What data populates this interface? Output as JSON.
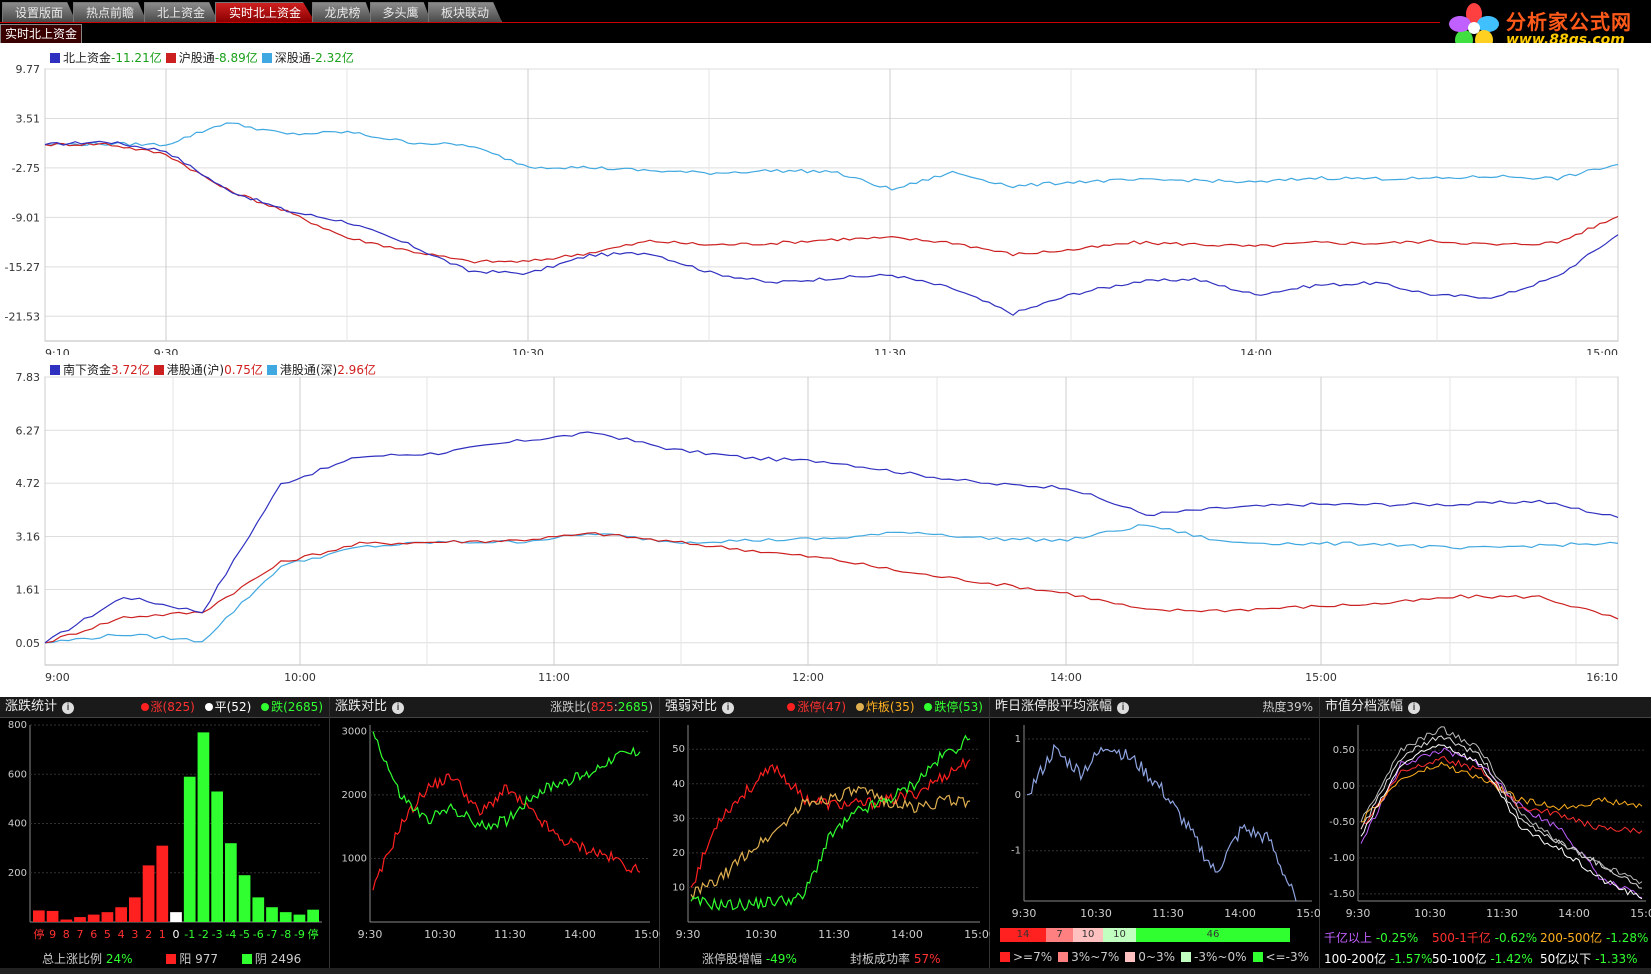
{
  "tabs": [
    {
      "label": "设置版面",
      "active": false
    },
    {
      "label": "热点前瞻",
      "active": false
    },
    {
      "label": "北上资金",
      "active": false
    },
    {
      "label": "实时北上资金",
      "active": true
    },
    {
      "label": "龙虎榜",
      "active": false
    },
    {
      "label": "多头鹰",
      "active": false
    },
    {
      "label": "板块联动",
      "active": false
    }
  ],
  "subtab": "实时北上资金",
  "logo": {
    "brand": "分析家公式网",
    "url": "www.88gs.com"
  },
  "colors": {
    "blue": "#3030c0",
    "red": "#cc2020",
    "cyan": "#40a8e0",
    "green": "#30ff30",
    "bred": "#ff2020",
    "yellow": "#e0b050"
  },
  "north": {
    "legend": [
      {
        "name": "北上资金",
        "value": "-11.21亿",
        "color": "#3030c0",
        "vclass": "v-green"
      },
      {
        "name": "沪股通",
        "value": "-8.89亿",
        "color": "#cc2020",
        "vclass": "v-green"
      },
      {
        "name": "深股通",
        "value": "-2.32亿",
        "color": "#40a8e0",
        "vclass": "v-green"
      }
    ],
    "y_ticks": [
      "9.77",
      "3.51",
      "-2.75",
      "-9.01",
      "-15.27",
      "-21.53"
    ],
    "x_ticks": [
      "9:10",
      "9:30",
      "10:30",
      "11:30",
      "14:00",
      "15:00"
    ]
  },
  "south": {
    "legend": [
      {
        "name": "南下资金",
        "value": "3.72亿",
        "color": "#3030c0",
        "vclass": "v-red"
      },
      {
        "name": "港股通(沪)",
        "value": "0.75亿",
        "color": "#cc2020",
        "vclass": "v-red"
      },
      {
        "name": "港股通(深)",
        "value": "2.96亿",
        "color": "#40a8e0",
        "vclass": "v-red"
      }
    ],
    "y_ticks": [
      "7.83",
      "6.27",
      "4.72",
      "3.16",
      "1.61",
      "0.05"
    ],
    "x_ticks": [
      "9:00",
      "10:00",
      "11:00",
      "12:00",
      "14:00",
      "15:00",
      "16:10"
    ]
  },
  "chart_data": [
    {
      "type": "line",
      "ylim": [
        -24.66,
        9.77
      ],
      "x": [
        "9:10",
        "9:20",
        "9:30",
        "9:40",
        "9:50",
        "10:00",
        "10:10",
        "10:20",
        "10:30",
        "10:40",
        "10:50",
        "11:00",
        "11:10",
        "11:20",
        "11:30",
        "13:10",
        "13:20",
        "13:30",
        "13:40",
        "13:50",
        "14:00",
        "14:10",
        "14:20",
        "14:30",
        "14:40",
        "14:50",
        "15:00"
      ],
      "series": [
        {
          "name": "北上资金",
          "values": [
            0.2,
            0.6,
            -0.6,
            -5.5,
            -8.2,
            -9.6,
            -12.4,
            -15.8,
            -16.1,
            -13.8,
            -13.5,
            -16.0,
            -17.3,
            -16.7,
            -16.3,
            -18.0,
            -21.2,
            -18.7,
            -17.2,
            -16.8,
            -18.8,
            -17.6,
            -17.3,
            -18.9,
            -19.1,
            -16.5,
            -11.2
          ]
        },
        {
          "name": "沪股通",
          "values": [
            0.2,
            0.3,
            -1.0,
            -5.5,
            -8.3,
            -11.6,
            -13.2,
            -14.6,
            -14.6,
            -13.5,
            -12.0,
            -12.5,
            -12.3,
            -11.8,
            -11.6,
            -12.2,
            -13.7,
            -13.1,
            -12.2,
            -12.4,
            -12.7,
            -12.2,
            -12.3,
            -12.0,
            -12.5,
            -12.2,
            -8.9
          ]
        },
        {
          "name": "深股通",
          "values": [
            0.2,
            0.3,
            0.2,
            3.0,
            1.5,
            1.8,
            0.5,
            0.1,
            -2.6,
            -2.7,
            -3.1,
            -3.4,
            -3.1,
            -3.2,
            -5.5,
            -3.3,
            -5.1,
            -4.5,
            -4.3,
            -4.3,
            -4.6,
            -4.0,
            -4.1,
            -4.1,
            -3.8,
            -4.1,
            -2.3
          ]
        }
      ]
    },
    {
      "type": "line",
      "ylim": [
        -0.6,
        7.83
      ],
      "x": [
        "9:00",
        "9:20",
        "9:40",
        "10:00",
        "10:20",
        "10:40",
        "11:00",
        "11:20",
        "11:40",
        "12:00",
        "12:20",
        "13:00",
        "13:20",
        "13:40",
        "14:00",
        "14:20",
        "14:40",
        "15:00",
        "15:20",
        "15:40",
        "16:10"
      ],
      "series": [
        {
          "name": "南下资金",
          "values": [
            0.05,
            1.4,
            0.95,
            4.7,
            5.5,
            5.6,
            5.95,
            6.2,
            5.7,
            5.45,
            5.35,
            5.0,
            4.7,
            4.6,
            3.8,
            4.0,
            4.1,
            4.1,
            4.1,
            4.2,
            3.72
          ]
        },
        {
          "name": "港股通(沪)",
          "values": [
            0.05,
            0.8,
            0.95,
            2.4,
            2.95,
            3.0,
            3.05,
            3.25,
            3.0,
            2.75,
            2.5,
            2.1,
            1.8,
            1.5,
            1.0,
            1.0,
            1.1,
            1.2,
            1.4,
            1.4,
            0.75
          ]
        },
        {
          "name": "港股通(深)",
          "values": [
            0.05,
            0.3,
            0.1,
            2.3,
            2.85,
            3.0,
            3.0,
            3.25,
            3.0,
            3.05,
            3.1,
            3.3,
            3.1,
            3.05,
            3.5,
            3.0,
            2.95,
            2.95,
            2.8,
            2.9,
            2.96
          ]
        }
      ]
    },
    {
      "type": "bar",
      "categories": [
        "停",
        "9",
        "8",
        "7",
        "6",
        "5",
        "4",
        "3",
        "2",
        "1",
        "0",
        "-1",
        "-2",
        "-3",
        "-4",
        "-5",
        "-6",
        "-7",
        "-8",
        "-9",
        "停"
      ],
      "values": [
        47,
        45,
        10,
        20,
        30,
        40,
        60,
        100,
        230,
        310,
        40,
        590,
        770,
        530,
        320,
        190,
        100,
        60,
        40,
        30,
        50
      ],
      "ylim": [
        0,
        800
      ],
      "y_ticks": [
        "800",
        "600",
        "400",
        "200"
      ]
    },
    {
      "type": "line",
      "ylim": [
        0,
        3100
      ],
      "x_ticks": [
        "9:30",
        "10:30",
        "11:30",
        "14:00",
        "15:00"
      ],
      "y_ticks": [
        "3000",
        "2000",
        "1000"
      ],
      "series": [
        {
          "name": "涨",
          "color": "#ff2020",
          "values": [
            500,
            1500,
            2100,
            2300,
            1700,
            2100,
            1700,
            1300,
            1150,
            1000,
            780
          ]
        },
        {
          "name": "跌",
          "color": "#30ff30",
          "values": [
            3000,
            2000,
            1600,
            1800,
            1500,
            1600,
            2000,
            2200,
            2300,
            2600,
            2680
          ]
        }
      ]
    },
    {
      "type": "line",
      "ylim": [
        0,
        57
      ],
      "x_ticks": [
        "9:30",
        "10:30",
        "11:30",
        "14:00",
        "15:00"
      ],
      "y_ticks": [
        "50",
        "40",
        "30",
        "20",
        "10"
      ],
      "series": [
        {
          "name": "涨停",
          "color": "#ff2020",
          "values": [
            10,
            30,
            38,
            45,
            36,
            34,
            34,
            35,
            37,
            42,
            47
          ]
        },
        {
          "name": "炸板",
          "color": "#e0b050",
          "values": [
            8,
            12,
            20,
            26,
            34,
            36,
            38,
            35,
            33,
            35,
            35
          ]
        },
        {
          "name": "跌停",
          "color": "#30ff30",
          "values": [
            6,
            5,
            5,
            6,
            7,
            25,
            32,
            35,
            40,
            48,
            53
          ]
        }
      ]
    },
    {
      "type": "line",
      "ylim": [
        -1.9,
        1.25
      ],
      "x_ticks": [
        "9:30",
        "10:30",
        "11:30",
        "14:00",
        "15:00"
      ],
      "y_ticks": [
        "1",
        "0",
        "-1"
      ],
      "series": [
        {
          "name": "昨日涨停股平均涨幅",
          "color": "#8ea4e0",
          "values": [
            0,
            0.8,
            0.4,
            0.9,
            0.6,
            0.1,
            -0.6,
            -1.4,
            -0.6,
            -0.8,
            -1.9
          ]
        }
      ]
    },
    {
      "type": "line",
      "ylim": [
        -1.6,
        0.85
      ],
      "x_ticks": [
        "9:30",
        "10:30",
        "11:30",
        "14:00",
        "15:00"
      ],
      "y_ticks": [
        "0.50",
        "0.00",
        "-0.50",
        "-1.00",
        "-1.50"
      ],
      "series": [
        {
          "name": "千亿以上",
          "values": [
            -0.8,
            0.3,
            0.5,
            0.3,
            -0.3,
            -0.6,
            -1.3,
            -1.55
          ]
        },
        {
          "name": "500-1千亿",
          "values": [
            -0.6,
            0.2,
            0.4,
            0.2,
            -0.3,
            -0.4,
            -0.6,
            -0.62
          ]
        },
        {
          "name": "200-500亿",
          "values": [
            -0.5,
            0.1,
            0.3,
            0.1,
            -0.2,
            -0.3,
            -0.2,
            -0.28
          ]
        },
        {
          "name": "100-200亿",
          "values": [
            -0.7,
            0.3,
            0.6,
            0.3,
            -0.6,
            -0.9,
            -1.3,
            -1.57
          ]
        },
        {
          "name": "50-100亿",
          "values": [
            -0.6,
            0.4,
            0.7,
            0.4,
            -0.5,
            -0.8,
            -1.1,
            -1.42
          ]
        },
        {
          "name": "50亿以下",
          "values": [
            -0.5,
            0.5,
            0.8,
            0.5,
            -0.4,
            -0.8,
            -1.1,
            -1.33
          ]
        }
      ]
    }
  ],
  "b1": {
    "title": "涨跌统计",
    "rise": "涨(825)",
    "flat": "平(52)",
    "fall": "跌(2685)",
    "ratio_label": "总上涨比例",
    "ratio": "24%",
    "yang": "阳 977",
    "yin": "阴 2496"
  },
  "b2": {
    "title": "涨跌对比",
    "ratio_label": "涨跌比(",
    "up": "825",
    "sep": ":",
    "down": "2685",
    "close": ")"
  },
  "b3": {
    "title": "强弱对比",
    "zt": "涨停(47)",
    "zb": "炸板(35)",
    "dt": "跌停(53)",
    "f1_label": "涨停股增幅",
    "f1": "-49%",
    "f2_label": "封板成功率",
    "f2": "57%"
  },
  "b4": {
    "title": "昨日涨停股平均涨幅",
    "heat": "热度39%",
    "bar": [
      {
        "v": "14",
        "c": "#ff2020",
        "w": 46
      },
      {
        "v": "7",
        "c": "#ff8080",
        "w": 27
      },
      {
        "v": "10",
        "c": "#ffc0c0",
        "w": 30
      },
      {
        "v": "10",
        "c": "#c0ffc0",
        "w": 33
      },
      {
        "v": "46",
        "c": "#30ff30",
        "w": 154
      }
    ],
    "keys": [
      {
        "t": ">=7%",
        "c": "#ff2020"
      },
      {
        "t": "3%~7%",
        "c": "#ff8080"
      },
      {
        "t": "0~3%",
        "c": "#ffc0c0"
      },
      {
        "t": "-3%~0%",
        "c": "#c0ffc0"
      },
      {
        "t": "<=-3%",
        "c": "#30ff30"
      }
    ]
  },
  "b5": {
    "title": "市值分档涨幅",
    "items": [
      {
        "label": "千亿以上",
        "value": "-0.25%",
        "lc": "#c060ff",
        "vc": "#30ff30"
      },
      {
        "label": "500-1千亿",
        "value": "-0.62%",
        "lc": "#ff3030",
        "vc": "#30ff30"
      },
      {
        "label": "200-500亿",
        "value": "-1.28%",
        "lc": "#ffb020",
        "vc": "#30ff30"
      },
      {
        "label": "100-200亿",
        "value": "-1.57%",
        "lc": "#ffffff",
        "vc": "#30ff30"
      },
      {
        "label": "50-100亿",
        "value": "-1.42%",
        "lc": "#ffffff",
        "vc": "#30ff30"
      },
      {
        "label": "50亿以下",
        "value": "-1.33%",
        "lc": "#ffffff",
        "vc": "#30ff30"
      }
    ]
  }
}
